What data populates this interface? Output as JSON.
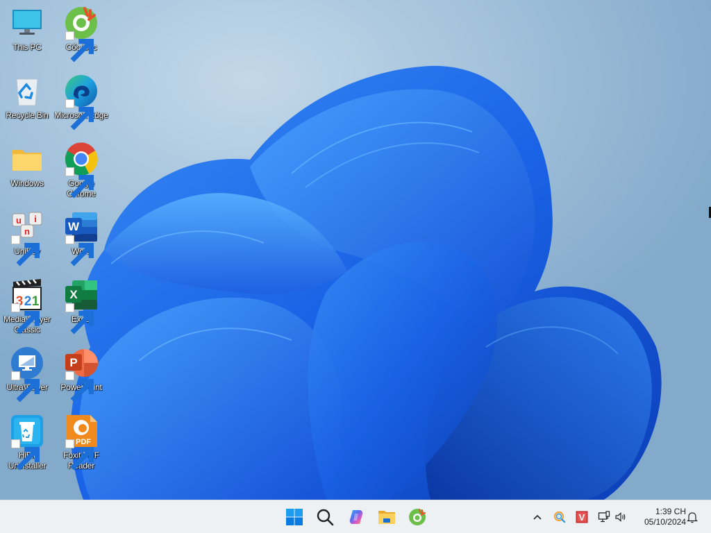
{
  "desktop": {
    "icons": [
      {
        "id": "this-pc",
        "label": "This PC",
        "shortcut": false,
        "icon": "monitor-icon"
      },
      {
        "id": "coc-coc",
        "label": "Cốc Cốc",
        "shortcut": true,
        "icon": "coccoc-icon"
      },
      {
        "id": "recycle-bin",
        "label": "Recycle Bin",
        "shortcut": false,
        "icon": "recycle-bin-icon"
      },
      {
        "id": "edge",
        "label": "Microsoft Edge",
        "shortcut": true,
        "icon": "edge-icon"
      },
      {
        "id": "windows-folder",
        "label": "Windows",
        "shortcut": false,
        "icon": "folder-icon"
      },
      {
        "id": "chrome",
        "label": "Google Chrome",
        "shortcut": true,
        "icon": "chrome-icon"
      },
      {
        "id": "unikey",
        "label": "UniKey",
        "shortcut": true,
        "icon": "unikey-icon",
        "keys": [
          "u",
          "i",
          "n"
        ]
      },
      {
        "id": "word",
        "label": "Word",
        "shortcut": true,
        "icon": "word-icon",
        "letter": "W"
      },
      {
        "id": "mpc",
        "label": "Media Player Classic",
        "shortcut": true,
        "icon": "media-player-icon",
        "digits": [
          "3",
          "2",
          "1"
        ]
      },
      {
        "id": "excel",
        "label": "Excel",
        "shortcut": true,
        "icon": "excel-icon",
        "letter": "X"
      },
      {
        "id": "ultraviewer",
        "label": "UltraViewer",
        "shortcut": true,
        "icon": "ultraviewer-icon"
      },
      {
        "id": "powerpoint",
        "label": "PowerPoint",
        "shortcut": true,
        "icon": "powerpoint-icon",
        "letter": "P"
      },
      {
        "id": "hibit",
        "label": "HiBit Uninstaller",
        "shortcut": true,
        "icon": "hibit-icon"
      },
      {
        "id": "foxit",
        "label": "Foxit PDF Reader",
        "shortcut": true,
        "icon": "foxit-icon",
        "badge": "PDF"
      }
    ]
  },
  "taskbar": {
    "pinned": [
      {
        "id": "start",
        "label": "Start",
        "icon": "windows-start-icon"
      },
      {
        "id": "search",
        "label": "Search",
        "icon": "search-icon"
      },
      {
        "id": "copilot",
        "label": "Copilot",
        "icon": "copilot-icon"
      },
      {
        "id": "explorer",
        "label": "File Explorer",
        "icon": "file-explorer-icon"
      },
      {
        "id": "coccoc",
        "label": "Cốc Cốc",
        "icon": "coccoc-icon"
      }
    ],
    "tray": [
      {
        "id": "overflow",
        "label": "Show hidden icons",
        "icon": "chevron-up-icon"
      },
      {
        "id": "tray-app-1",
        "label": "Search tool",
        "icon": "magnifier-color-icon"
      },
      {
        "id": "tray-unikey",
        "label": "UniKey (Vietnamese mode)",
        "icon": "unikey-v-icon",
        "letter": "V"
      },
      {
        "id": "network",
        "label": "Network",
        "icon": "network-icon"
      },
      {
        "id": "volume",
        "label": "Volume",
        "icon": "speaker-icon"
      }
    ],
    "clock": {
      "time": "1:39 CH",
      "date": "05/10/2024"
    },
    "notifications": {
      "label": "Notifications",
      "icon": "bell-icon"
    }
  }
}
